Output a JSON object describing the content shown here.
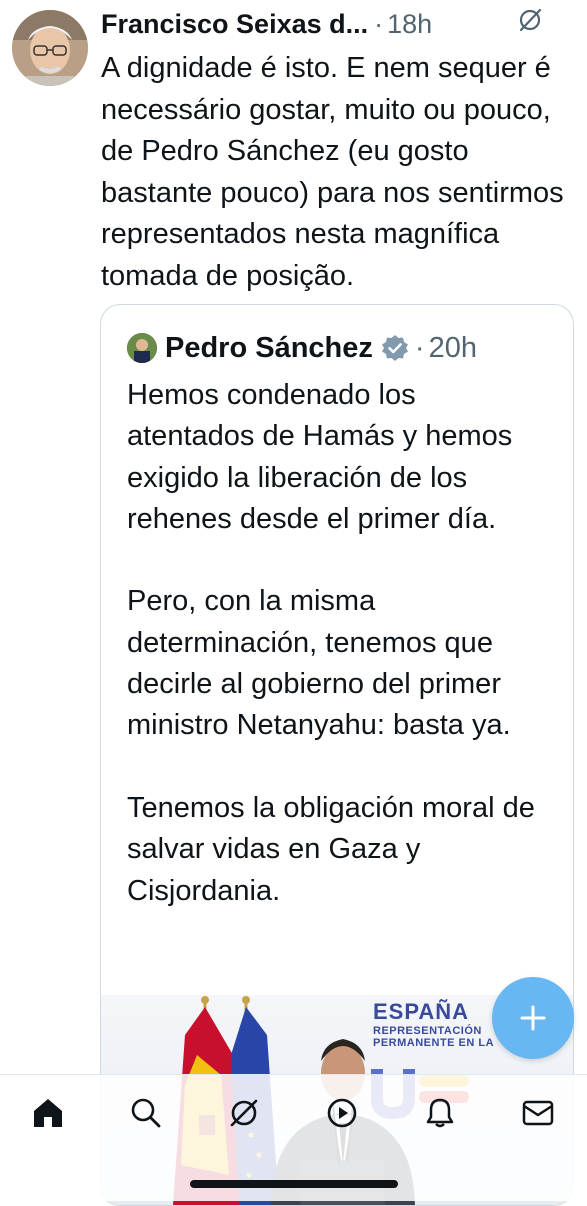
{
  "tweet": {
    "author_name": "Francisco Seixas d...",
    "separator": "·",
    "time": "18h",
    "text": "A dignidade é isto. E nem sequer é necessário gostar, muito ou pouco, de Pedro Sánchez (eu gosto bastante pouco) para nos sentirmos representados nesta magnífica tomada de posição."
  },
  "quoted_tweet": {
    "author_name": "Pedro Sánchez",
    "verified": true,
    "separator": "·",
    "time": "20h",
    "text": "Hemos condenado los atentados de Hamás y hemos exigido la liberación de los rehenes desde el primer día.\n\nPero, con la misma determinación, tenemos que decirle al gobierno del primer ministro Netanyahu: basta ya.\n\nTenemos la obligación moral de salvar vidas en Gaza y Cisjordania.",
    "media_brand": {
      "line1": "ESPAÑA",
      "line2": "REPRESENTACIÓN",
      "line3": "PERMANENTE EN LA"
    }
  },
  "fab": {
    "icon": "plus-icon"
  },
  "tab_bar": {
    "items": [
      {
        "icon": "home-icon",
        "active": true
      },
      {
        "icon": "search-icon",
        "active": false
      },
      {
        "icon": "grok-icon",
        "active": false
      },
      {
        "icon": "video-icon",
        "active": false
      },
      {
        "icon": "bell-icon",
        "active": false
      },
      {
        "icon": "mail-icon",
        "active": false
      }
    ]
  },
  "colors": {
    "text": "#0f1419",
    "secondary": "#536471",
    "accent": "#1d9bf0",
    "fab": "#66b7f2",
    "border": "#cfd9de"
  }
}
